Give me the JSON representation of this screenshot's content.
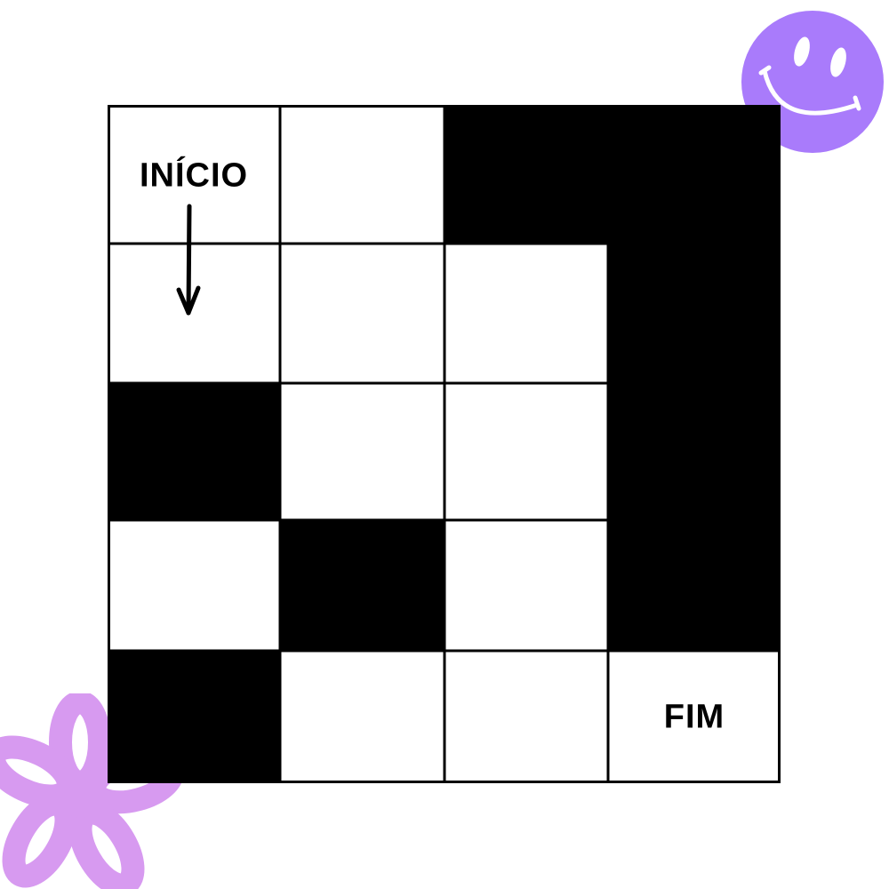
{
  "maze": {
    "start_label": "INÍCIO",
    "end_label": "FIM",
    "rows": 5,
    "cols": 4,
    "grid": [
      [
        0,
        0,
        1,
        1
      ],
      [
        0,
        0,
        0,
        1
      ],
      [
        1,
        0,
        0,
        1
      ],
      [
        0,
        1,
        0,
        1
      ],
      [
        1,
        0,
        0,
        0
      ]
    ],
    "start_cell": [
      0,
      0
    ],
    "end_cell": [
      4,
      3
    ],
    "wall_color": "#000000",
    "path_color": "#ffffff"
  },
  "decorations": {
    "smiley_color": "#a97bfb",
    "flower_color": "#d79af0",
    "smiley_icon": "smiley-face-icon",
    "flower_icon": "flower-icon",
    "arrow_icon": "arrow-down-icon"
  }
}
